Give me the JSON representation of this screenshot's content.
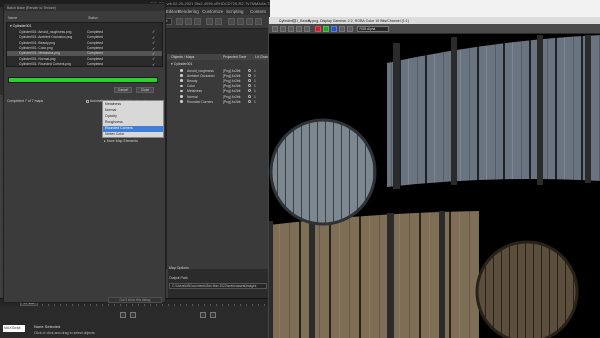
{
  "max_title": "002_PB_vdr.02-25-2021 Sts2-4096-vRHDCD720-R2-Tv7MMAAb-72ts",
  "menubar": {
    "items": [
      "Graph Editors",
      "Rendering",
      "Customize",
      "Scripting",
      "Content"
    ]
  },
  "toolbar": {
    "view_dropdown": "View"
  },
  "dialog": {
    "title": "Batch Bake (Render to Texture)",
    "header": {
      "col_name": "Name",
      "col_status": "Status"
    },
    "group": "Cylinder001",
    "jobs": [
      {
        "name": "Cylinder001: Arnold_roughness.png",
        "status": "Completed",
        "check": "✓"
      },
      {
        "name": "Cylinder001: Ambient Occlusion.png",
        "status": "Completed",
        "check": "✓"
      },
      {
        "name": "Cylinder001: Beauty.png",
        "status": "Completed",
        "check": "✓"
      },
      {
        "name": "Cylinder001: Color.png",
        "status": "Completed",
        "check": "✓"
      },
      {
        "name": "Cylinder001: Metalness.png",
        "status": "Completed",
        "check": "✓"
      },
      {
        "name": "Cylinder001: Normal.png",
        "status": "Completed",
        "check": "✓"
      },
      {
        "name": "Cylinder001: Rounded Corners.png",
        "status": "Completed",
        "check": "✓"
      }
    ],
    "progress": 1.0,
    "cancel_label": "Cancel",
    "close_label": "Close",
    "completed_text": "Completed 7 of 7 maps",
    "auto_close_label": "Automatically close this dialog when done",
    "bottom_button": "Don't show this dialog"
  },
  "element_list": {
    "items": [
      "Metalness",
      "Normal",
      "Opacity",
      "Roughness",
      "Rounded Corners",
      "Vertex Color"
    ],
    "selected_index": 4,
    "more_label": "More Map Elements"
  },
  "rtt": {
    "col_objects": "Objects / Maps",
    "col_format": "Projected Tone",
    "col_enabled": "Lit Chan",
    "group": "Cylinder001",
    "rows": [
      {
        "name": "Arnold_roughness",
        "format": "[Png] 4x2bit",
        "on": "1"
      },
      {
        "name": "Ambient Occlusion",
        "format": "[Png] 4x2bit",
        "on": "1"
      },
      {
        "name": "Beauty",
        "format": "[Png] 4x2bit",
        "on": "1"
      },
      {
        "name": "Color",
        "format": "[Png] 4x2bit",
        "on": "1"
      },
      {
        "name": "Metalness",
        "format": "[Png] 4x2bit",
        "on": "1"
      },
      {
        "name": "Normal",
        "format": "[Png] 4x2bit",
        "on": "1"
      },
      {
        "name": "Rounded Corners",
        "format": "[Png] 4x2bit",
        "on": "1"
      }
    ],
    "map_options": "Map Options",
    "output_path_label": "Output Path",
    "output_path": "C:\\Users\\tdl\\Documents\\3ds Max 2022\\sceneassets\\images"
  },
  "timeline": {
    "frame": "0 / 100"
  },
  "status": {
    "maxscript": "MAXScript",
    "line1": "None Selected",
    "line2": "Click or click-and-drag to select objects"
  },
  "framebuffer": {
    "title": "Cylinder001_Beauty.png, Display Gamma: 2.2, RGBA Color 16 Bits/Channel (1:1)",
    "channel": "RGB Alpha",
    "win_buttons": "– ▢ ✕"
  }
}
